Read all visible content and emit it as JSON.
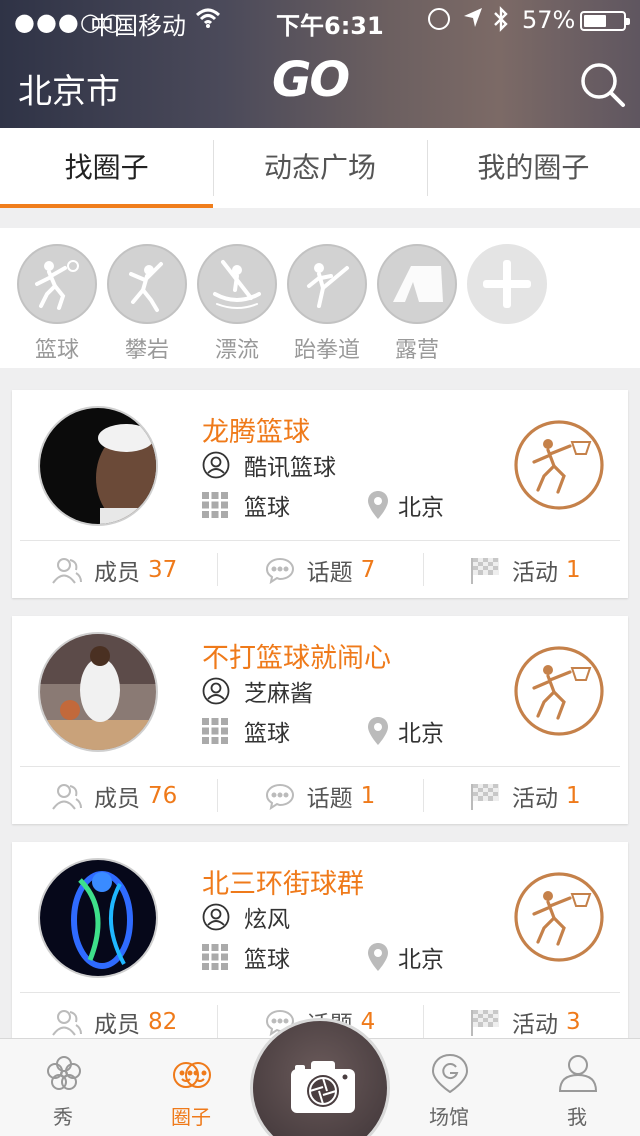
{
  "status_bar": {
    "signal": "●●●○○",
    "carrier": "中国移动",
    "time": "下午6:31",
    "battery": "57%",
    "battery_level": 0.57
  },
  "header": {
    "city": "北京市",
    "logo": "GO"
  },
  "tabs": [
    {
      "label": "找圈子",
      "active": true
    },
    {
      "label": "动态广场",
      "active": false
    },
    {
      "label": "我的圈子",
      "active": false
    }
  ],
  "categories": [
    {
      "label": "篮球",
      "icon": "basketball-icon"
    },
    {
      "label": "攀岩",
      "icon": "climbing-icon"
    },
    {
      "label": "漂流",
      "icon": "rafting-icon"
    },
    {
      "label": "跆拳道",
      "icon": "taekwondo-icon"
    },
    {
      "label": "露营",
      "icon": "camping-icon"
    }
  ],
  "groups": [
    {
      "name": "龙腾篮球",
      "owner": "酷讯篮球",
      "sport": "篮球",
      "city": "北京",
      "members_label": "成员",
      "members": "37",
      "topics_label": "话题",
      "topics": "7",
      "events_label": "活动",
      "events": "1"
    },
    {
      "name": "不打篮球就闹心",
      "owner": "芝麻酱",
      "sport": "篮球",
      "city": "北京",
      "members_label": "成员",
      "members": "76",
      "topics_label": "话题",
      "topics": "1",
      "events_label": "活动",
      "events": "1"
    },
    {
      "name": "北三环街球群",
      "owner": "炫风",
      "sport": "篮球",
      "city": "北京",
      "members_label": "成员",
      "members": "82",
      "topics_label": "话题",
      "topics": "4",
      "events_label": "活动",
      "events": "3"
    }
  ],
  "tabbar": [
    {
      "label": "秀",
      "icon": "flower-icon",
      "active": false
    },
    {
      "label": "圈子",
      "icon": "circle-faces-icon",
      "active": true
    },
    {
      "label": "场馆",
      "icon": "venue-pin-icon",
      "active": false
    },
    {
      "label": "我",
      "icon": "profile-icon",
      "active": false
    }
  ],
  "colors": {
    "accent": "#ef7a1a",
    "badge": "#c5814a",
    "category_bg": "#d2d2d2"
  }
}
